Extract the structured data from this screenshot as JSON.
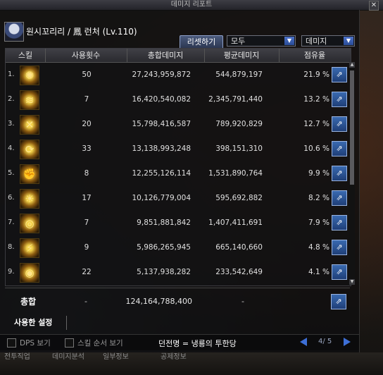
{
  "window": {
    "title": "데미지 리포트",
    "close_glyph": "✕"
  },
  "character": {
    "name": "원시꼬리리 / 鳳 런처 (Lv.110)"
  },
  "toolbar": {
    "reset_label": "리셋하기",
    "filter_value": "모두",
    "metric_value": "데미지",
    "dropdown_glyph": "▼"
  },
  "table": {
    "headers": {
      "skill": "스킬",
      "uses": "사용횟수",
      "total": "총합데미지",
      "avg": "평균데미지",
      "share": "점유율"
    },
    "rows": [
      {
        "idx": "1.",
        "icon": "gear-burst-icon",
        "glyph": "✺",
        "uses": "50",
        "total": "27,243,959,872",
        "avg": "544,879,197",
        "share": "21.9 %"
      },
      {
        "idx": "2.",
        "icon": "flame-wave-icon",
        "glyph": "≋",
        "uses": "7",
        "total": "16,420,540,082",
        "avg": "2,345,791,440",
        "share": "13.2 %"
      },
      {
        "idx": "3.",
        "icon": "cross-blast-icon",
        "glyph": "✕",
        "uses": "20",
        "total": "15,798,416,587",
        "avg": "789,920,829",
        "share": "12.7 %"
      },
      {
        "idx": "4.",
        "icon": "spiral-cannon-icon",
        "glyph": "⟳",
        "uses": "33",
        "total": "13,138,993,248",
        "avg": "398,151,310",
        "share": "10.6 %"
      },
      {
        "idx": "5.",
        "icon": "claw-strike-icon",
        "glyph": "✊",
        "uses": "8",
        "total": "12,255,126,114",
        "avg": "1,531,890,764",
        "share": "9.9 %"
      },
      {
        "idx": "6.",
        "icon": "sun-burst-icon",
        "glyph": "☀",
        "uses": "17",
        "total": "10,126,779,004",
        "avg": "595,692,882",
        "share": "8.2 %"
      },
      {
        "idx": "7.",
        "icon": "rings-icon",
        "glyph": "◎",
        "uses": "7",
        "total": "9,851,881,842",
        "avg": "1,407,411,691",
        "share": "7.9 %"
      },
      {
        "idx": "8.",
        "icon": "slash-wave-icon",
        "glyph": "⚡",
        "uses": "9",
        "total": "5,986,265,945",
        "avg": "665,140,660",
        "share": "4.8 %"
      },
      {
        "idx": "9.",
        "icon": "eye-beam-icon",
        "glyph": "◉",
        "uses": "22",
        "total": "5,137,938,282",
        "avg": "233,542,649",
        "share": "4.1 %"
      }
    ],
    "share_glyph": "⇗",
    "scroll_up": "▲",
    "scroll_down": "▼"
  },
  "total": {
    "label": "총합",
    "uses": "-",
    "total": "124,164,788,400",
    "avg": "-"
  },
  "used_settings_label": "사용한 설정",
  "footer": {
    "dps_label": "DPS 보기",
    "skill_order_label": "스킬 순서 보기",
    "dungeon_text": "던전명 = 냉룡의 투한당",
    "page": "4/ 5"
  },
  "bottom_tabs": [
    "전투직업",
    "데미지분석",
    "일부정보",
    "공제정보"
  ],
  "colors": {
    "accent": "#3d6fd6",
    "panel": "#0e0e10"
  }
}
